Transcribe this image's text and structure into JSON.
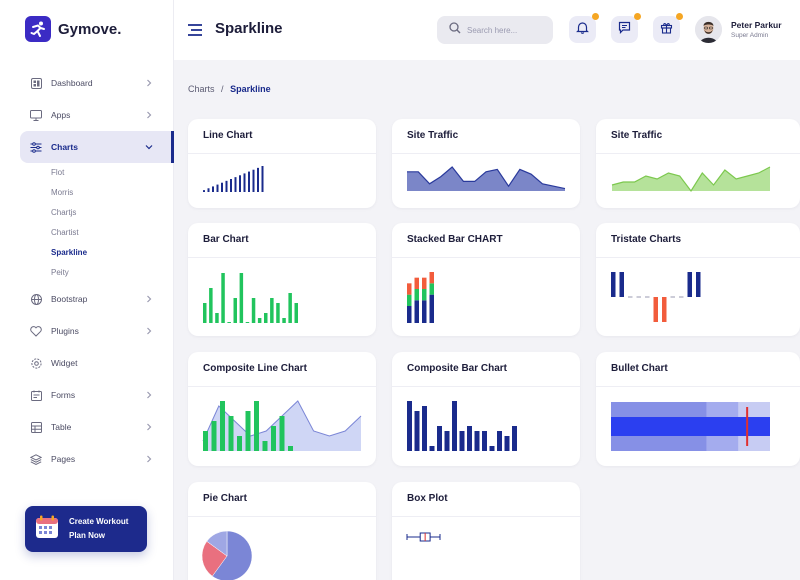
{
  "brand": {
    "name": "Gymove."
  },
  "sidebar": {
    "items": [
      {
        "label": "Dashboard",
        "icon": "dashboard-icon"
      },
      {
        "label": "Apps",
        "icon": "monitor-icon"
      },
      {
        "label": "Charts",
        "icon": "sliders-icon",
        "active": true
      },
      {
        "label": "Bootstrap",
        "icon": "globe-icon"
      },
      {
        "label": "Plugins",
        "icon": "heart-icon"
      },
      {
        "label": "Widget",
        "icon": "settings-icon"
      },
      {
        "label": "Forms",
        "icon": "forms-icon"
      },
      {
        "label": "Table",
        "icon": "table-icon"
      },
      {
        "label": "Pages",
        "icon": "layers-icon"
      }
    ],
    "submenu": [
      "Flot",
      "Morris",
      "Chartjs",
      "Chartist",
      "Sparkline",
      "Peity"
    ],
    "submenu_current": "Sparkline",
    "cta": {
      "line1": "Create Workout",
      "line2": "Plan Now"
    }
  },
  "header": {
    "title": "Sparkline",
    "search_placeholder": "Search here...",
    "user_name": "Peter Parkur",
    "user_role": "Super Admin"
  },
  "breadcrumb": {
    "parent": "Charts",
    "separator": "/",
    "current": "Sparkline"
  },
  "colors": {
    "accent": "#1a2b8c",
    "green": "#21c45d",
    "notification": "#f5a623",
    "orange": "#f25c3c",
    "pie_blue": "#7b86d6",
    "pie_pink": "#e9707f"
  },
  "cards": {
    "line_chart": {
      "title": "Line Chart"
    },
    "site_traffic_1": {
      "title": "Site Traffic"
    },
    "site_traffic_2": {
      "title": "Site Traffic"
    },
    "bar_chart": {
      "title": "Bar Chart"
    },
    "stacked_bar": {
      "title": "Stacked Bar CHART"
    },
    "tristate": {
      "title": "Tristate Charts"
    },
    "composite_line": {
      "title": "Composite Line Chart"
    },
    "composite_bar": {
      "title": "Composite Bar Chart"
    },
    "bullet": {
      "title": "Bullet Chart"
    },
    "pie": {
      "title": "Pie Chart"
    },
    "box_plot": {
      "title": "Box Plot"
    }
  },
  "chart_data": [
    {
      "type": "bar",
      "id": "line_chart",
      "values": [
        1,
        2,
        3,
        4,
        5,
        6,
        7,
        8,
        9,
        10,
        11,
        12,
        13,
        14
      ]
    },
    {
      "type": "area",
      "id": "site_traffic_1",
      "values": [
        8,
        8,
        3,
        6,
        10,
        4,
        4,
        8,
        9,
        2,
        9,
        7,
        3,
        2,
        1
      ]
    },
    {
      "type": "area",
      "id": "site_traffic_2",
      "values": [
        2,
        3,
        3,
        5,
        4,
        6,
        5,
        0,
        6,
        2,
        7,
        4,
        5,
        6,
        8
      ]
    },
    {
      "type": "bar",
      "id": "bar_chart",
      "values": [
        4,
        7,
        2,
        10,
        0,
        5,
        10,
        0,
        5,
        1,
        2,
        5,
        4,
        1,
        6,
        4
      ]
    },
    {
      "type": "stacked-bar",
      "id": "stacked_bar",
      "series": [
        {
          "values": [
            3,
            4,
            4,
            5
          ]
        },
        {
          "values": [
            2,
            2,
            2,
            2
          ]
        },
        {
          "values": [
            2,
            2,
            2,
            2
          ]
        }
      ]
    },
    {
      "type": "tristate",
      "id": "tristate",
      "values": [
        1,
        1,
        0,
        0,
        0,
        -1,
        -1,
        0,
        0,
        1,
        1
      ]
    },
    {
      "type": "composite",
      "id": "composite_line",
      "bars": [
        4,
        6,
        10,
        7,
        3,
        8,
        10,
        2,
        5,
        7,
        1
      ],
      "line": [
        2,
        9,
        6,
        3,
        4,
        7,
        10,
        4,
        3,
        4,
        7
      ]
    },
    {
      "type": "composite-bar",
      "id": "composite_bar",
      "bars": [
        10,
        8,
        9,
        1,
        5,
        4,
        10,
        4,
        5,
        4,
        4,
        1,
        4,
        3,
        5
      ],
      "bars2": [
        0,
        0,
        1,
        1,
        0,
        0,
        3,
        0,
        0,
        0,
        0,
        0,
        0,
        0,
        0
      ]
    },
    {
      "type": "bullet",
      "id": "bullet",
      "ranges": [
        100,
        80,
        60
      ],
      "value": 100,
      "target": 85
    },
    {
      "type": "pie",
      "id": "pie",
      "values": [
        60,
        25,
        15
      ]
    },
    {
      "type": "box",
      "id": "box_plot",
      "min": 0,
      "q1": 8,
      "median": 11,
      "q3": 14,
      "max": 20
    }
  ]
}
